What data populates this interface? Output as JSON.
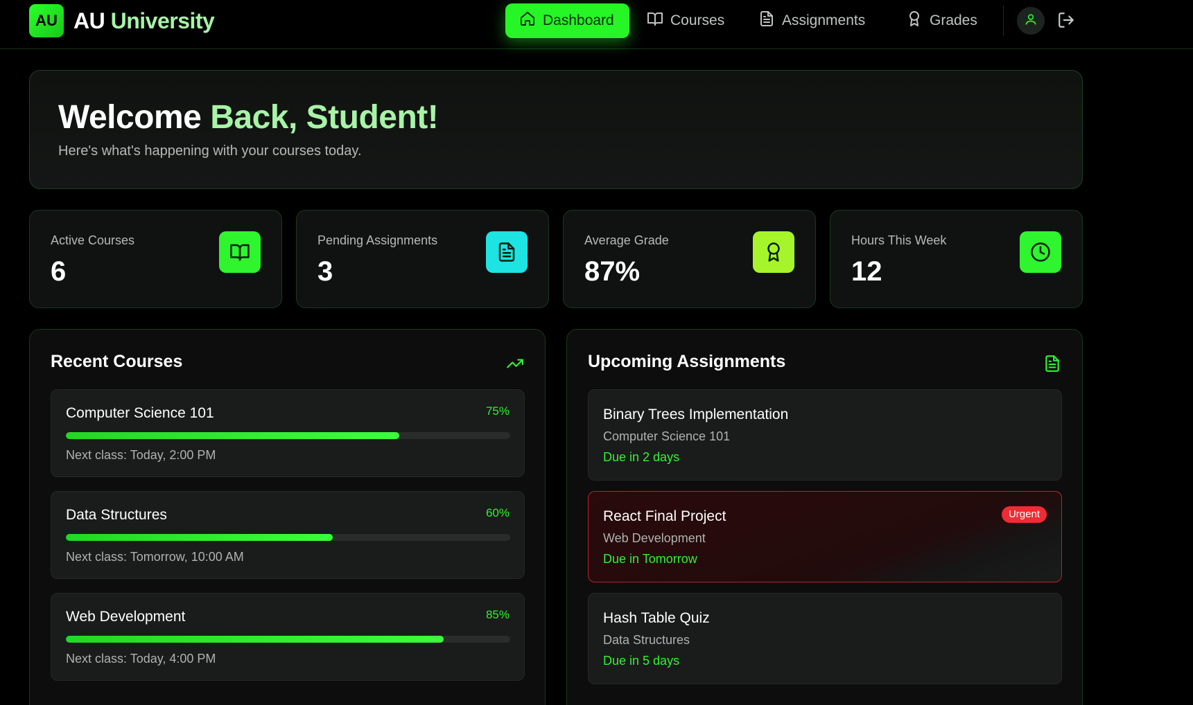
{
  "header": {
    "logo_text": "AU",
    "brand_part1": "AU",
    "brand_part2": "University",
    "nav": [
      {
        "label": "Dashboard",
        "icon": "home-icon",
        "active": true
      },
      {
        "label": "Courses",
        "icon": "book-open-icon",
        "active": false
      },
      {
        "label": "Assignments",
        "icon": "file-text-icon",
        "active": false
      },
      {
        "label": "Grades",
        "icon": "award-icon",
        "active": false
      }
    ]
  },
  "welcome": {
    "greeting_part1": "Welcome",
    "greeting_part2": "Back, Student!",
    "subtitle": "Here's what's happening with your courses today."
  },
  "stats": [
    {
      "label": "Active Courses",
      "value": "6",
      "icon": "book-open-icon",
      "color": "#2ef52e"
    },
    {
      "label": "Pending Assignments",
      "value": "3",
      "icon": "file-text-icon",
      "color": "#1ee3e3"
    },
    {
      "label": "Average Grade",
      "value": "87%",
      "icon": "award-icon",
      "color": "#a6f52a"
    },
    {
      "label": "Hours This Week",
      "value": "12",
      "icon": "clock-icon",
      "color": "#2ef52e"
    }
  ],
  "recent_courses": {
    "title": "Recent Courses",
    "items": [
      {
        "name": "Computer Science 101",
        "progress_text": "75%",
        "progress": 75,
        "next": "Next class: Today, 2:00 PM"
      },
      {
        "name": "Data Structures",
        "progress_text": "60%",
        "progress": 60,
        "next": "Next class: Tomorrow, 10:00 AM"
      },
      {
        "name": "Web Development",
        "progress_text": "85%",
        "progress": 85,
        "next": "Next class: Today, 4:00 PM"
      }
    ]
  },
  "upcoming_assignments": {
    "title": "Upcoming Assignments",
    "items": [
      {
        "title": "Binary Trees Implementation",
        "course": "Computer Science 101",
        "due": "Due in 2 days"
      },
      {
        "title": "React Final Project",
        "course": "Web Development",
        "due": "Due in Tomorrow",
        "badge": "Urgent"
      },
      {
        "title": "Hash Table Quiz",
        "course": "Data Structures",
        "due": "Due in 5 days"
      }
    ]
  },
  "colors": {
    "accent": "#2ef52e",
    "accent_light": "#a7f3a7",
    "urgent": "#ef2b35"
  }
}
